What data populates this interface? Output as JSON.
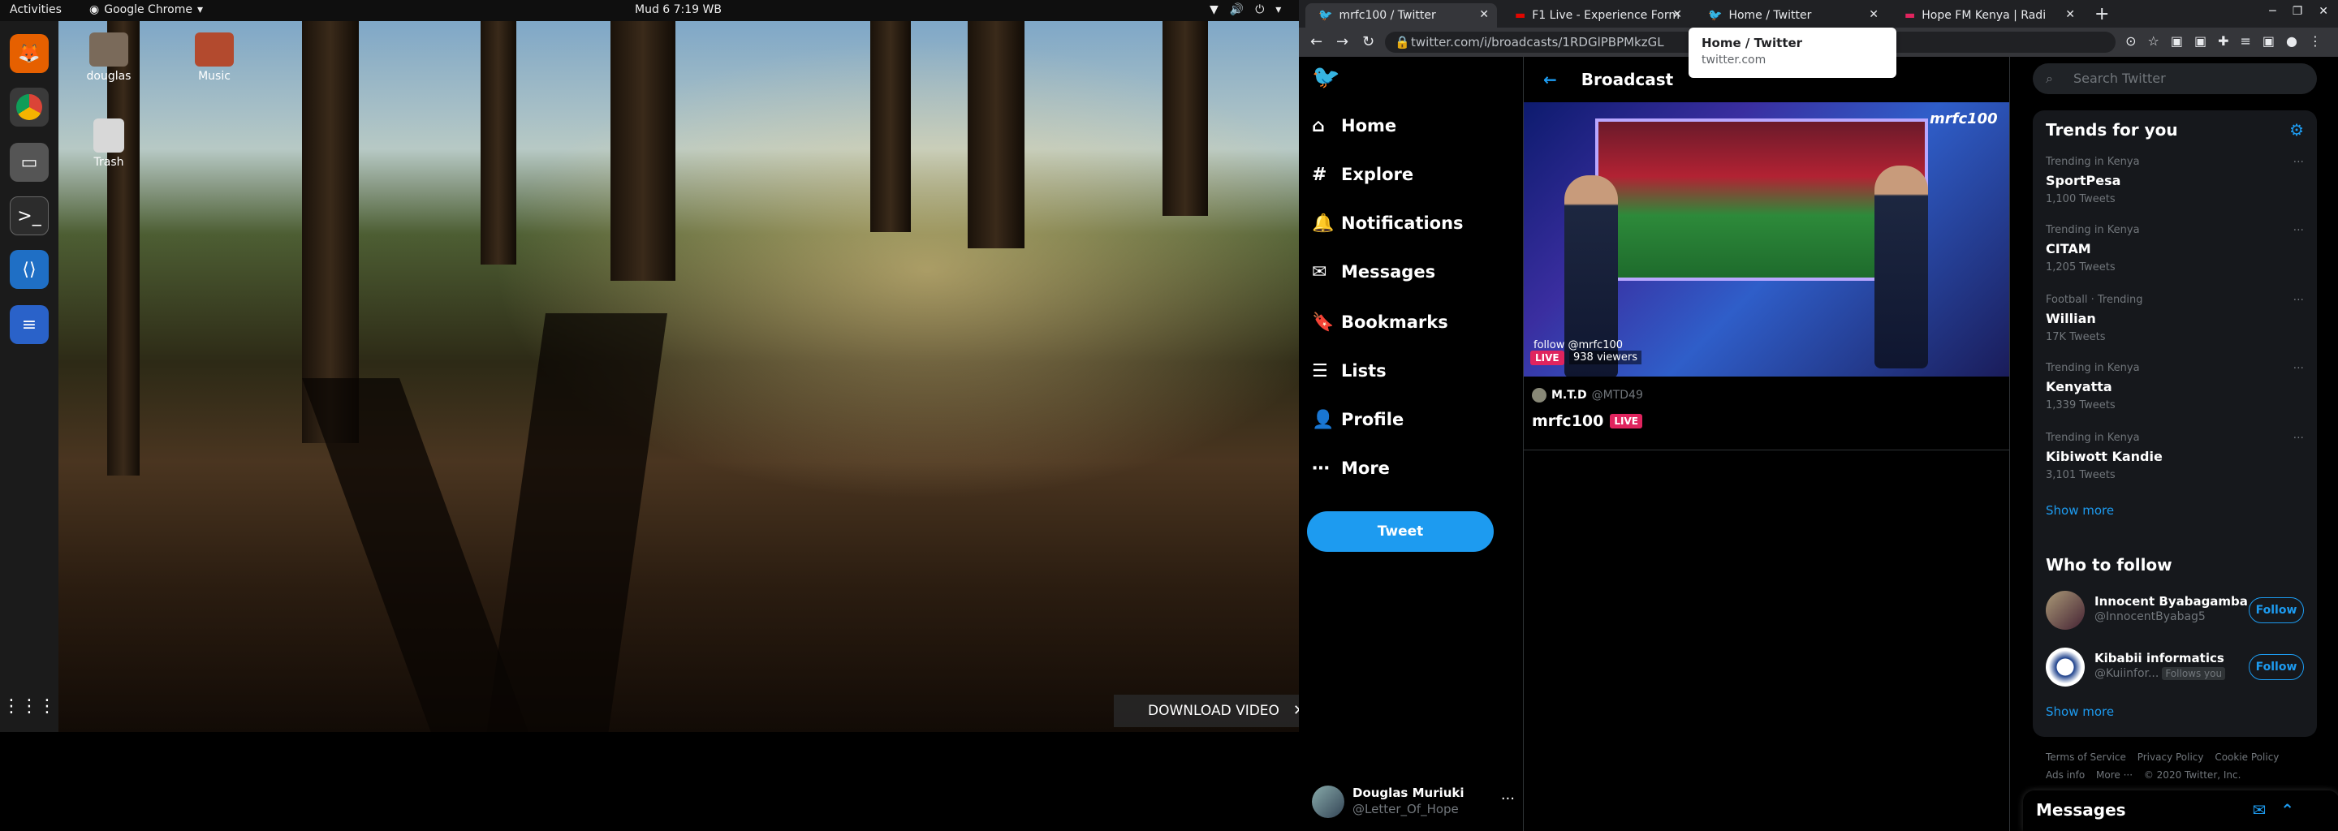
{
  "topbar": {
    "activities": "Activities",
    "app_name": "Google Chrome",
    "clock": "Mud 6  7:19 WB"
  },
  "desktop": {
    "icons": [
      {
        "label": "douglas"
      },
      {
        "label": "Music"
      },
      {
        "label": "Trash"
      }
    ],
    "download_label": "DOWNLOAD VIDEO"
  },
  "chrome": {
    "tabs": [
      {
        "title": "mrfc100 / Twitter"
      },
      {
        "title": "F1 Live - Experience Form"
      },
      {
        "title": "Home / Twitter"
      },
      {
        "title": "Hope FM Kenya | Radi"
      }
    ],
    "url": "twitter.com/i/broadcasts/1RDGlPBPMkzGL",
    "tooltip_title": "Home / Twitter",
    "tooltip_url": "twitter.com"
  },
  "twitter": {
    "nav": [
      {
        "label": "Home",
        "icon": "home-icon"
      },
      {
        "label": "Explore",
        "icon": "hashtag-icon"
      },
      {
        "label": "Notifications",
        "icon": "bell-icon"
      },
      {
        "label": "Messages",
        "icon": "mail-icon"
      },
      {
        "label": "Bookmarks",
        "icon": "bookmark-icon"
      },
      {
        "label": "Lists",
        "icon": "list-icon"
      },
      {
        "label": "Profile",
        "icon": "person-icon"
      },
      {
        "label": "More",
        "icon": "more-icon"
      }
    ],
    "tweet_button": "Tweet",
    "account": {
      "name": "Douglas Muriuki",
      "handle": "@Letter_Of_Hope"
    },
    "header_title": "Broadcast",
    "video": {
      "overlay_logo": "mrfc100",
      "follow_text": "follow @mrfc100",
      "live_label": "LIVE",
      "viewers": "938 viewers"
    },
    "broadcaster": {
      "name": "M.T.D",
      "handle": "@MTD49"
    },
    "broadcast_title": "mrfc100",
    "broadcast_badge": "LIVE",
    "search_placeholder": "Search Twitter",
    "trends_title": "Trends for you",
    "trends": [
      {
        "context": "Trending in Kenya",
        "name": "SportPesa",
        "count": "1,100 Tweets"
      },
      {
        "context": "Trending in Kenya",
        "name": "CITAM",
        "count": "1,205 Tweets"
      },
      {
        "context": "Football · Trending",
        "name": "Willian",
        "count": "17K Tweets"
      },
      {
        "context": "Trending in Kenya",
        "name": "Kenyatta",
        "count": "1,339 Tweets"
      },
      {
        "context": "Trending in Kenya",
        "name": "Kibiwott Kandie",
        "count": "3,101 Tweets"
      }
    ],
    "show_more": "Show more",
    "who_to_follow_title": "Who to follow",
    "who_to_follow": [
      {
        "name": "Innocent Byabagamba",
        "handle": "@InnocentByabag5",
        "follows_you": "",
        "button": "Follow"
      },
      {
        "name": "Kibabii informatics",
        "handle": "@Kuiinfor...",
        "follows_you": "Follows you",
        "button": "Follow"
      }
    ],
    "footer": {
      "terms": "Terms of Service",
      "privacy": "Privacy Policy",
      "cookies": "Cookie Policy",
      "ads": "Ads info",
      "more": "More ···",
      "copyright": "© 2020 Twitter, Inc."
    },
    "messages_dock": "Messages"
  }
}
